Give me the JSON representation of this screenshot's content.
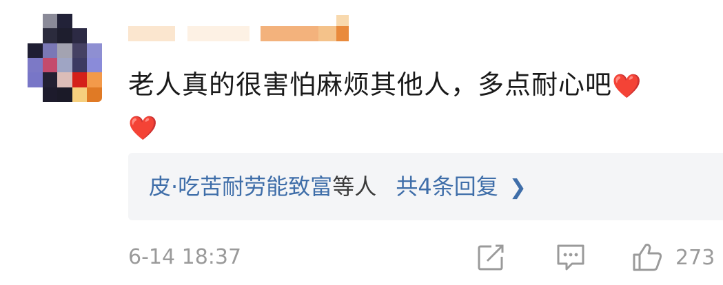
{
  "comment": {
    "text": "老人真的很害怕麻烦其他人，多点耐心吧",
    "emoji_icon": "red-heart-icon"
  },
  "replies": {
    "names": "皮·吃苦耐劳能致富",
    "suffix": "等人",
    "count_label": "共4条回复"
  },
  "footer": {
    "timestamp": "6-14 18:37",
    "like_count": "273"
  },
  "colors": {
    "link_blue": "#3f6ea9",
    "heart_red": "#e0352b",
    "reply_bg": "#f4f5f7",
    "meta_gray": "#9a9a9a"
  }
}
